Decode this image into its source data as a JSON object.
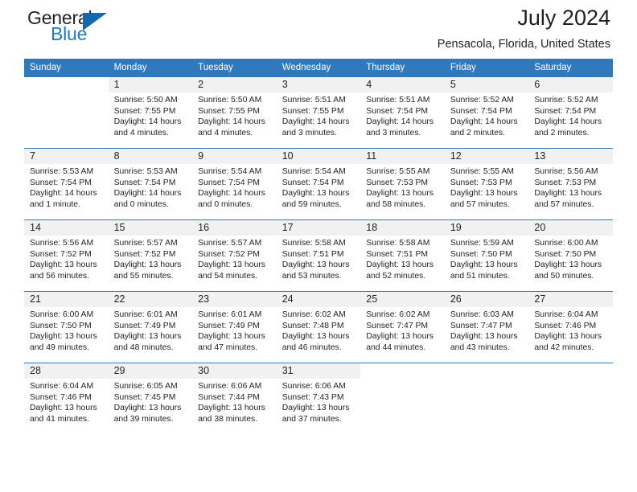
{
  "brand": {
    "name_part1": "General",
    "name_part2": "Blue",
    "triangle_icon": "triangle-icon"
  },
  "header": {
    "title": "July 2024",
    "subtitle": "Pensacola, Florida, United States"
  },
  "colors": {
    "header_blue": "#3079bd",
    "logo_blue": "#2079c4",
    "daynum_background": "#f1f1f1",
    "text": "#231f20"
  },
  "weekday_headers": [
    "Sunday",
    "Monday",
    "Tuesday",
    "Wednesday",
    "Thursday",
    "Friday",
    "Saturday"
  ],
  "weeks": [
    [
      {
        "day": "",
        "sunrise": "",
        "sunset": "",
        "daylight_line1": "",
        "daylight_line2": "",
        "blank": true
      },
      {
        "day": "1",
        "sunrise": "Sunrise: 5:50 AM",
        "sunset": "Sunset: 7:55 PM",
        "daylight_line1": "Daylight: 14 hours",
        "daylight_line2": "and 4 minutes."
      },
      {
        "day": "2",
        "sunrise": "Sunrise: 5:50 AM",
        "sunset": "Sunset: 7:55 PM",
        "daylight_line1": "Daylight: 14 hours",
        "daylight_line2": "and 4 minutes."
      },
      {
        "day": "3",
        "sunrise": "Sunrise: 5:51 AM",
        "sunset": "Sunset: 7:55 PM",
        "daylight_line1": "Daylight: 14 hours",
        "daylight_line2": "and 3 minutes."
      },
      {
        "day": "4",
        "sunrise": "Sunrise: 5:51 AM",
        "sunset": "Sunset: 7:54 PM",
        "daylight_line1": "Daylight: 14 hours",
        "daylight_line2": "and 3 minutes."
      },
      {
        "day": "5",
        "sunrise": "Sunrise: 5:52 AM",
        "sunset": "Sunset: 7:54 PM",
        "daylight_line1": "Daylight: 14 hours",
        "daylight_line2": "and 2 minutes."
      },
      {
        "day": "6",
        "sunrise": "Sunrise: 5:52 AM",
        "sunset": "Sunset: 7:54 PM",
        "daylight_line1": "Daylight: 14 hours",
        "daylight_line2": "and 2 minutes."
      }
    ],
    [
      {
        "day": "7",
        "sunrise": "Sunrise: 5:53 AM",
        "sunset": "Sunset: 7:54 PM",
        "daylight_line1": "Daylight: 14 hours",
        "daylight_line2": "and 1 minute."
      },
      {
        "day": "8",
        "sunrise": "Sunrise: 5:53 AM",
        "sunset": "Sunset: 7:54 PM",
        "daylight_line1": "Daylight: 14 hours",
        "daylight_line2": "and 0 minutes."
      },
      {
        "day": "9",
        "sunrise": "Sunrise: 5:54 AM",
        "sunset": "Sunset: 7:54 PM",
        "daylight_line1": "Daylight: 14 hours",
        "daylight_line2": "and 0 minutes."
      },
      {
        "day": "10",
        "sunrise": "Sunrise: 5:54 AM",
        "sunset": "Sunset: 7:54 PM",
        "daylight_line1": "Daylight: 13 hours",
        "daylight_line2": "and 59 minutes."
      },
      {
        "day": "11",
        "sunrise": "Sunrise: 5:55 AM",
        "sunset": "Sunset: 7:53 PM",
        "daylight_line1": "Daylight: 13 hours",
        "daylight_line2": "and 58 minutes."
      },
      {
        "day": "12",
        "sunrise": "Sunrise: 5:55 AM",
        "sunset": "Sunset: 7:53 PM",
        "daylight_line1": "Daylight: 13 hours",
        "daylight_line2": "and 57 minutes."
      },
      {
        "day": "13",
        "sunrise": "Sunrise: 5:56 AM",
        "sunset": "Sunset: 7:53 PM",
        "daylight_line1": "Daylight: 13 hours",
        "daylight_line2": "and 57 minutes."
      }
    ],
    [
      {
        "day": "14",
        "sunrise": "Sunrise: 5:56 AM",
        "sunset": "Sunset: 7:52 PM",
        "daylight_line1": "Daylight: 13 hours",
        "daylight_line2": "and 56 minutes."
      },
      {
        "day": "15",
        "sunrise": "Sunrise: 5:57 AM",
        "sunset": "Sunset: 7:52 PM",
        "daylight_line1": "Daylight: 13 hours",
        "daylight_line2": "and 55 minutes."
      },
      {
        "day": "16",
        "sunrise": "Sunrise: 5:57 AM",
        "sunset": "Sunset: 7:52 PM",
        "daylight_line1": "Daylight: 13 hours",
        "daylight_line2": "and 54 minutes."
      },
      {
        "day": "17",
        "sunrise": "Sunrise: 5:58 AM",
        "sunset": "Sunset: 7:51 PM",
        "daylight_line1": "Daylight: 13 hours",
        "daylight_line2": "and 53 minutes."
      },
      {
        "day": "18",
        "sunrise": "Sunrise: 5:58 AM",
        "sunset": "Sunset: 7:51 PM",
        "daylight_line1": "Daylight: 13 hours",
        "daylight_line2": "and 52 minutes."
      },
      {
        "day": "19",
        "sunrise": "Sunrise: 5:59 AM",
        "sunset": "Sunset: 7:50 PM",
        "daylight_line1": "Daylight: 13 hours",
        "daylight_line2": "and 51 minutes."
      },
      {
        "day": "20",
        "sunrise": "Sunrise: 6:00 AM",
        "sunset": "Sunset: 7:50 PM",
        "daylight_line1": "Daylight: 13 hours",
        "daylight_line2": "and 50 minutes."
      }
    ],
    [
      {
        "day": "21",
        "sunrise": "Sunrise: 6:00 AM",
        "sunset": "Sunset: 7:50 PM",
        "daylight_line1": "Daylight: 13 hours",
        "daylight_line2": "and 49 minutes."
      },
      {
        "day": "22",
        "sunrise": "Sunrise: 6:01 AM",
        "sunset": "Sunset: 7:49 PM",
        "daylight_line1": "Daylight: 13 hours",
        "daylight_line2": "and 48 minutes."
      },
      {
        "day": "23",
        "sunrise": "Sunrise: 6:01 AM",
        "sunset": "Sunset: 7:49 PM",
        "daylight_line1": "Daylight: 13 hours",
        "daylight_line2": "and 47 minutes."
      },
      {
        "day": "24",
        "sunrise": "Sunrise: 6:02 AM",
        "sunset": "Sunset: 7:48 PM",
        "daylight_line1": "Daylight: 13 hours",
        "daylight_line2": "and 46 minutes."
      },
      {
        "day": "25",
        "sunrise": "Sunrise: 6:02 AM",
        "sunset": "Sunset: 7:47 PM",
        "daylight_line1": "Daylight: 13 hours",
        "daylight_line2": "and 44 minutes."
      },
      {
        "day": "26",
        "sunrise": "Sunrise: 6:03 AM",
        "sunset": "Sunset: 7:47 PM",
        "daylight_line1": "Daylight: 13 hours",
        "daylight_line2": "and 43 minutes."
      },
      {
        "day": "27",
        "sunrise": "Sunrise: 6:04 AM",
        "sunset": "Sunset: 7:46 PM",
        "daylight_line1": "Daylight: 13 hours",
        "daylight_line2": "and 42 minutes."
      }
    ],
    [
      {
        "day": "28",
        "sunrise": "Sunrise: 6:04 AM",
        "sunset": "Sunset: 7:46 PM",
        "daylight_line1": "Daylight: 13 hours",
        "daylight_line2": "and 41 minutes."
      },
      {
        "day": "29",
        "sunrise": "Sunrise: 6:05 AM",
        "sunset": "Sunset: 7:45 PM",
        "daylight_line1": "Daylight: 13 hours",
        "daylight_line2": "and 39 minutes."
      },
      {
        "day": "30",
        "sunrise": "Sunrise: 6:06 AM",
        "sunset": "Sunset: 7:44 PM",
        "daylight_line1": "Daylight: 13 hours",
        "daylight_line2": "and 38 minutes."
      },
      {
        "day": "31",
        "sunrise": "Sunrise: 6:06 AM",
        "sunset": "Sunset: 7:43 PM",
        "daylight_line1": "Daylight: 13 hours",
        "daylight_line2": "and 37 minutes."
      },
      {
        "day": "",
        "sunrise": "",
        "sunset": "",
        "daylight_line1": "",
        "daylight_line2": "",
        "blank": true
      },
      {
        "day": "",
        "sunrise": "",
        "sunset": "",
        "daylight_line1": "",
        "daylight_line2": "",
        "blank": true
      },
      {
        "day": "",
        "sunrise": "",
        "sunset": "",
        "daylight_line1": "",
        "daylight_line2": "",
        "blank": true
      }
    ]
  ]
}
